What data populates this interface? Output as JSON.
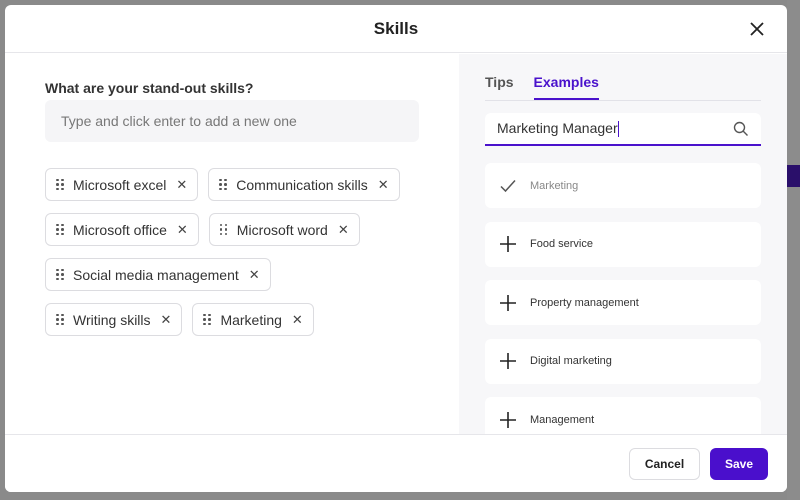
{
  "modal": {
    "title": "Skills"
  },
  "left": {
    "question": "What are your stand-out skills?",
    "input_placeholder": "Type and click enter to add a new one",
    "skills": [
      "Microsoft excel",
      "Communication skills",
      "Microsoft office",
      "Microsoft word",
      "Social media management",
      "Writing skills",
      "Marketing"
    ]
  },
  "right": {
    "tabs": [
      {
        "label": "Tips",
        "active": false
      },
      {
        "label": "Examples",
        "active": true
      }
    ],
    "search_value": "Marketing Manager",
    "examples": [
      {
        "label": "Marketing",
        "added": true,
        "icon": "check-icon"
      },
      {
        "label": "Food service",
        "added": false,
        "icon": "plus-icon"
      },
      {
        "label": "Property management",
        "added": false,
        "icon": "plus-icon"
      },
      {
        "label": "Digital marketing",
        "added": false,
        "icon": "plus-icon"
      },
      {
        "label": "Management",
        "added": false,
        "icon": "plus-icon"
      }
    ]
  },
  "footer": {
    "cancel_label": "Cancel",
    "save_label": "Save"
  },
  "colors": {
    "accent": "#4a0fcc"
  }
}
